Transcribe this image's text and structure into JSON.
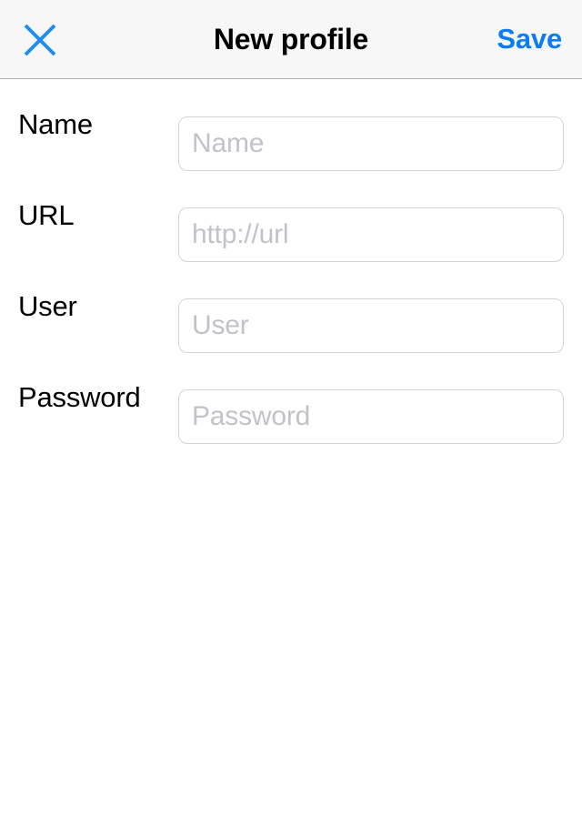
{
  "header": {
    "title": "New profile",
    "close_icon": "close-x-icon",
    "save_label": "Save",
    "accent_color": "#0a7cf4",
    "background_color": "#f7f7f7",
    "title_color": "#000000",
    "border_color": "#b2b2b2"
  },
  "form": {
    "fields": [
      {
        "label": "Name",
        "placeholder": "Name",
        "value": "",
        "type": "text",
        "name": "name"
      },
      {
        "label": "URL",
        "placeholder": "http://url",
        "value": "",
        "type": "text",
        "name": "url"
      },
      {
        "label": "User",
        "placeholder": "User",
        "value": "",
        "type": "text",
        "name": "user"
      },
      {
        "label": "Password",
        "placeholder": "Password",
        "value": "",
        "type": "password",
        "name": "password"
      }
    ],
    "placeholder_color": "#c2c2c8",
    "input_border_color": "#d4d4d4",
    "background_color": "#ffffff"
  }
}
